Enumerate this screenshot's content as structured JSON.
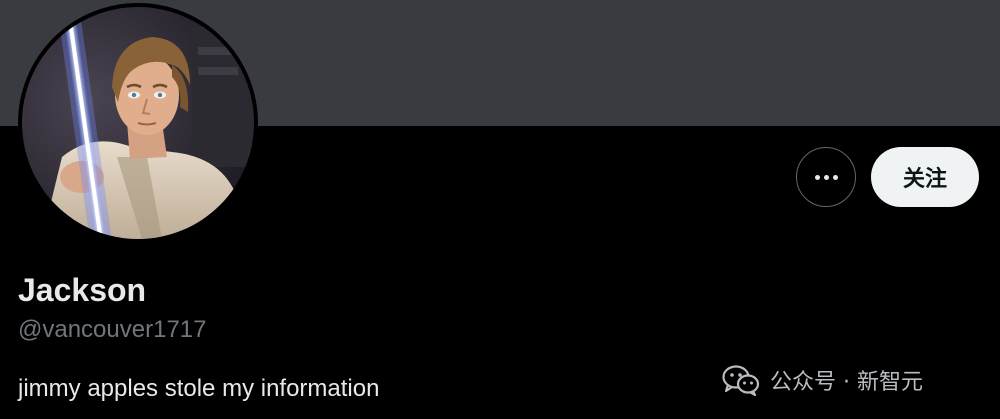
{
  "profile": {
    "display_name": "Jackson",
    "handle": "@vancouver1717",
    "bio": "jimmy apples stole my information",
    "avatar_icon": "profile-avatar-photo"
  },
  "actions": {
    "more_icon": "ellipsis-icon",
    "follow_label": "关注"
  },
  "watermark": {
    "icon": "wechat-icon",
    "text": "公众号 · 新智元"
  },
  "colors": {
    "banner": "#3a3b40",
    "background": "#000000",
    "follow_button_bg": "#eff3f4",
    "handle_text": "#71767b"
  }
}
